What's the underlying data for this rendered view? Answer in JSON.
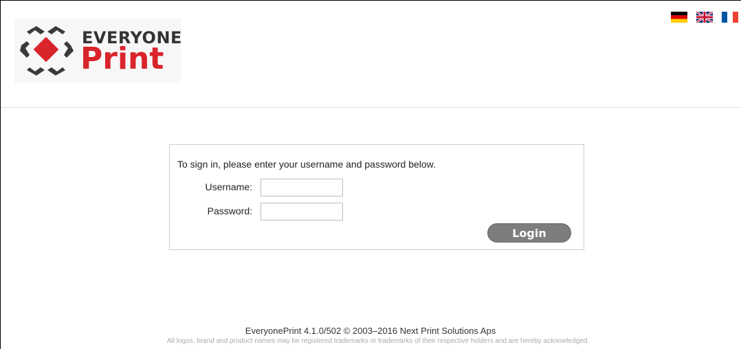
{
  "brand": {
    "logo_top": "EVERYONE",
    "logo_bottom": "Print",
    "accent_color": "#d9242b",
    "text_color": "#333333"
  },
  "languages": [
    {
      "name": "German",
      "icon": "german-flag-icon"
    },
    {
      "name": "English",
      "icon": "uk-flag-icon"
    },
    {
      "name": "French",
      "icon": "french-flag-icon"
    }
  ],
  "login": {
    "intro": "To sign in, please enter your username and password below.",
    "username_label": "Username:",
    "username_value": "",
    "password_label": "Password:",
    "password_value": "",
    "button_label": "Login"
  },
  "footer": {
    "main": "EveryonePrint 4.1.0/502 © 2003–2016 Next Print Solutions Aps",
    "sub": "All logos, brand and product names may be registered trademarks or trademarks of their respective holders and are hereby acknowledged."
  }
}
